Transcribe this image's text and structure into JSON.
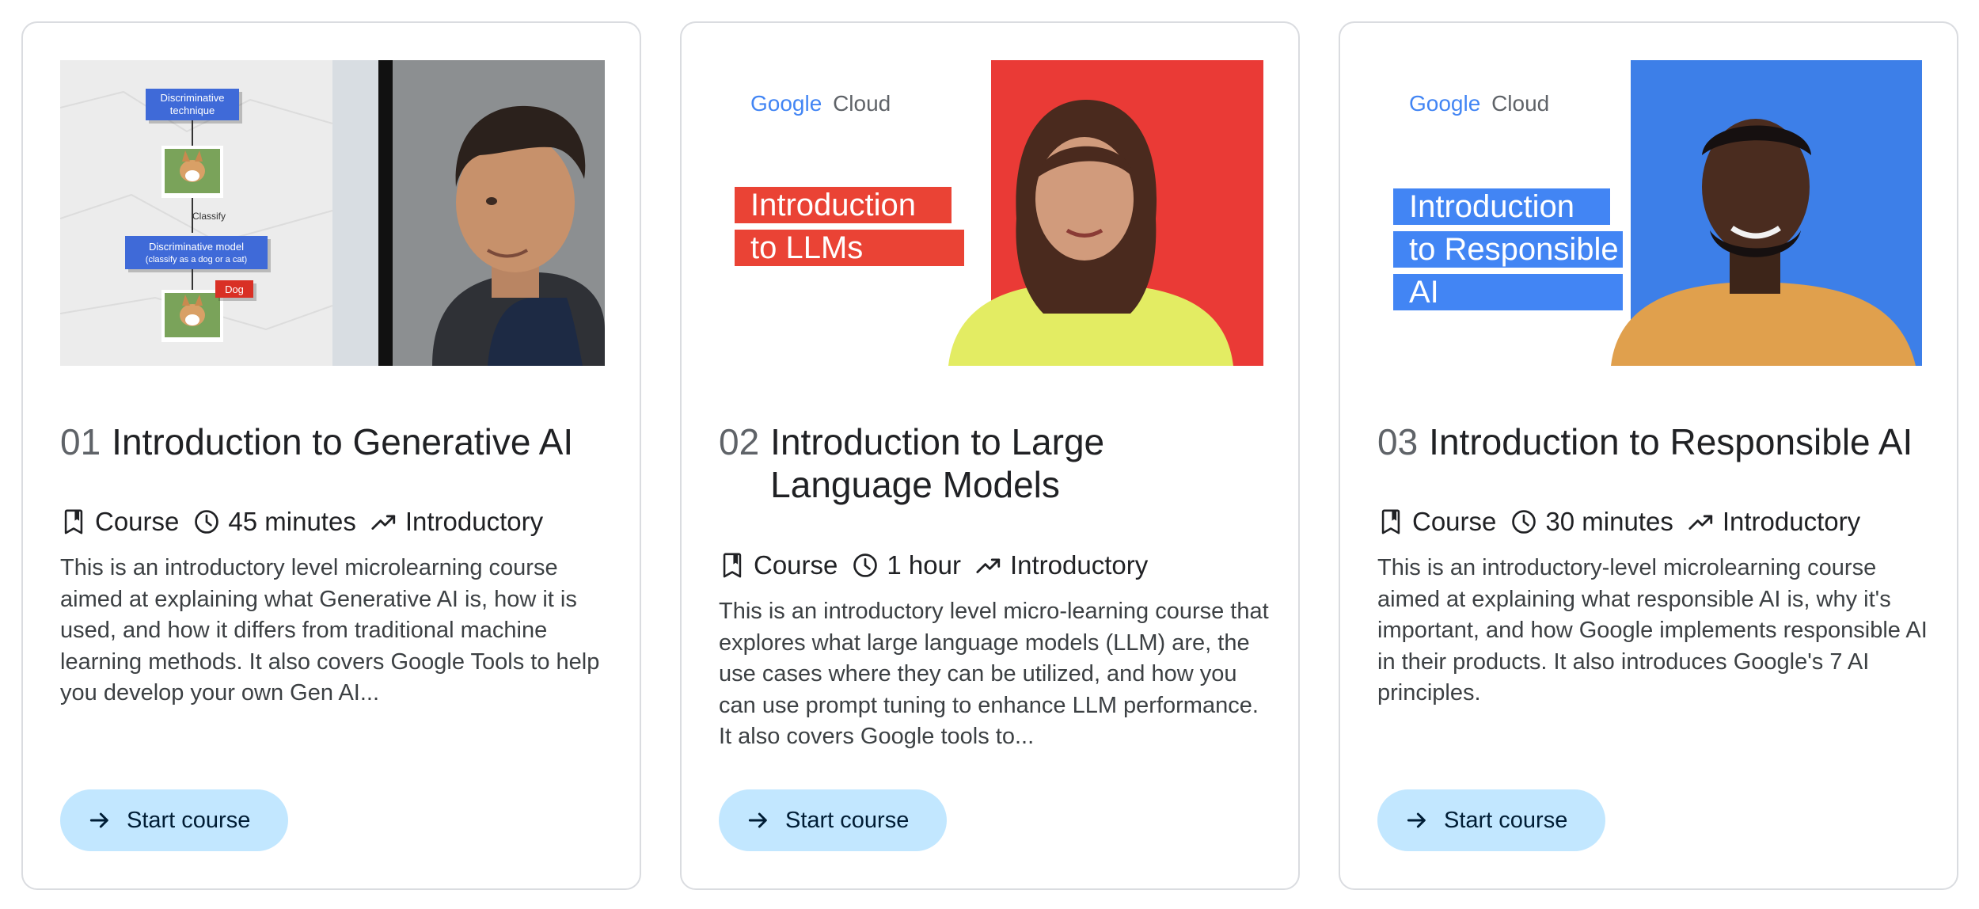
{
  "courses": [
    {
      "number": "01",
      "title": "Introduction to Generative AI",
      "type": "Course",
      "duration": "45 minutes",
      "level": "Introductory",
      "description": "This is an introductory level microlearning course aimed at explaining what Generative AI is, how it is used, and how it differs from traditional machine learning methods. It also covers Google Tools to help you develop your own Gen AI...",
      "button_label": "Start course",
      "thumbnail": {
        "diagram_top": [
          "Discriminative",
          "technique"
        ],
        "diagram_mid_label": "Classify",
        "diagram_model": [
          "Discriminative model",
          "(classify as a dog or a cat)"
        ],
        "diagram_tag": "Dog"
      }
    },
    {
      "number": "02",
      "title": "Introduction to Large Language Models",
      "type": "Course",
      "duration": "1 hour",
      "level": "Introductory",
      "description": "This is an introductory level micro-learning course that explores what large language models (LLM) are, the use cases where they can be utilized, and how you can use prompt tuning to enhance LLM performance. It also covers Google tools to...",
      "button_label": "Start course",
      "thumbnail": {
        "brand_google": "Google",
        "brand_cloud": "Cloud",
        "headline": [
          "Introduction",
          "to LLMs"
        ],
        "accent": "#ea4335"
      }
    },
    {
      "number": "03",
      "title": "Introduction to Responsible AI",
      "type": "Course",
      "duration": "30 minutes",
      "level": "Introductory",
      "description": "This is an introductory-level microlearning course aimed at explaining what responsible AI is, why it's important, and how Google implements responsible AI in their products. It also introduces Google's 7 AI principles.",
      "button_label": "Start course",
      "thumbnail": {
        "brand_google": "Google",
        "brand_cloud": "Cloud",
        "headline": [
          "Introduction",
          "to Responsible",
          "AI"
        ],
        "accent": "#4285f4"
      }
    }
  ],
  "colors": {
    "card_border": "#dadce0",
    "button_bg": "#c2e7ff",
    "button_text": "#001d35",
    "number_text": "#5f6368"
  },
  "icons": {
    "type": "bookmark-icon",
    "duration": "clock-icon",
    "level": "trending-up-icon",
    "button": "arrow-forward-icon"
  }
}
